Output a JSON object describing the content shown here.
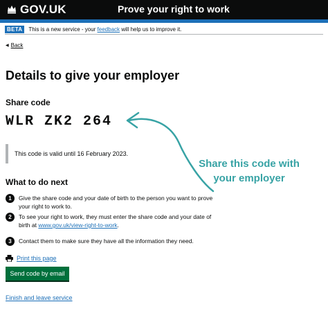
{
  "header": {
    "logo_text": "GOV.UK",
    "service_name": "Prove your right to work"
  },
  "phase_banner": {
    "tag": "BETA",
    "text_before": "This is a new service - your",
    "link": "feedback",
    "text_after": "will help us to improve it."
  },
  "back_link": "Back",
  "page_title": "Details to give your employer",
  "share_code": {
    "label": "Share code",
    "code": "WLR ZK2 264"
  },
  "validity_text": "This code is valid until 16 February 2023.",
  "annotation": {
    "line1": "Share this code with",
    "line2": "your employer",
    "color": "#38a3a5"
  },
  "next_steps": {
    "heading": "What to do next",
    "items": [
      {
        "number": "1",
        "text": "Give the share code and your date of birth to the person you want to prove your right to work to."
      },
      {
        "number": "2",
        "text_before": "To see your right to work, they must enter the share code and your date of birth at",
        "link": "www.gov.uk/view-right-to-work",
        "text_after": "."
      },
      {
        "number": "3",
        "text": "Contact them to make sure they have all the information they need."
      }
    ]
  },
  "print_link": "Print this page",
  "send_button": "Send code by email",
  "finish_link": "Finish and leave service",
  "colors": {
    "header_bg": "#0b0c0c",
    "accent_blue": "#1d70b8",
    "button_green": "#00703c",
    "link_blue": "#1d70b8"
  },
  "icons": [
    "crown-icon",
    "back-triangle-icon",
    "printer-icon",
    "curved-arrow-icon"
  ]
}
